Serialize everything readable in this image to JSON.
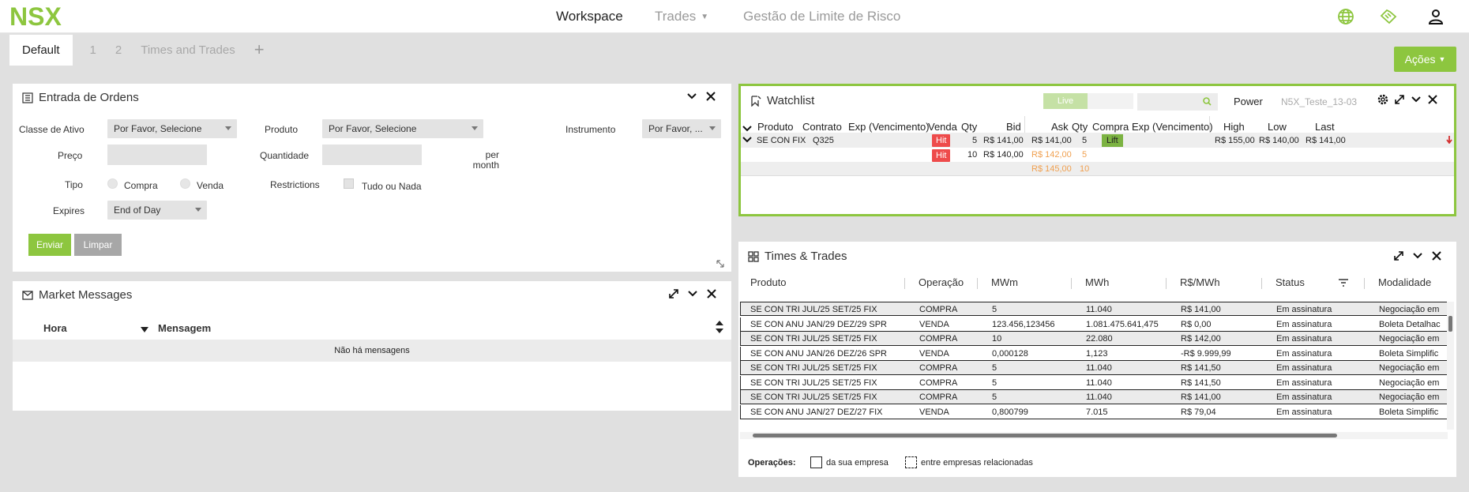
{
  "brand": {
    "logo_text": "NSX",
    "color": "#8dc63f"
  },
  "nav": {
    "workspace": "Workspace",
    "trades": "Trades",
    "gestao": "Gestão de Limite de Risco"
  },
  "top_icons": [
    "globe-icon",
    "handshake-icon",
    "user-icon"
  ],
  "tabs": [
    {
      "label": "Default",
      "active": true
    },
    {
      "label": "1"
    },
    {
      "label": "2"
    },
    {
      "label": "Times and Trades"
    }
  ],
  "tab_add": "+",
  "acoes_label": "Ações",
  "ordens": {
    "title": "Entrada de Ordens",
    "classe_label": "Classe de Ativo",
    "classe_value": "Por Favor, Selecione",
    "produto_label": "Produto",
    "produto_value": "Por Favor, Selecione",
    "instrumento_label": "Instrumento",
    "instrumento_value": "Por Favor, ...",
    "preco_label": "Preço",
    "quantidade_label": "Quantidade",
    "per_month_1": "per",
    "per_month_2": "month",
    "tipo_label": "Tipo",
    "compra_label": "Compra",
    "venda_label": "Venda",
    "restrictions_label": "Restrictions",
    "tudo_label": "Tudo ou Nada",
    "expires_label": "Expires",
    "expires_value": "End of Day",
    "enviar_label": "Enviar",
    "limpar_label": "Limpar"
  },
  "market": {
    "title": "Market Messages",
    "col_hora": "Hora",
    "col_mensagem": "Mensagem",
    "empty": "Não há mensagens"
  },
  "watchlist": {
    "title": "Watchlist",
    "live_label": "Live",
    "power_label": "Power",
    "profile": "N5X_Teste_13-03",
    "headers": {
      "produto": "Produto",
      "contrato": "Contrato",
      "exp1": "Exp (Vencimento)",
      "venda": "Venda",
      "qty1": "Qty",
      "bid": "Bid",
      "ask": "Ask",
      "qty2": "Qty",
      "compra": "Compra",
      "exp2": "Exp (Vencimento)",
      "high": "High",
      "low": "Low",
      "last": "Last"
    },
    "row": {
      "produto": "SE CON FIX",
      "contrato": "Q325",
      "bids": [
        {
          "hit": "Hit",
          "qty": "5",
          "bid": "R$ 141,00"
        },
        {
          "hit": "Hit",
          "qty": "10",
          "bid": "R$ 140,00"
        }
      ],
      "asks": [
        {
          "ask": "R$ 141,00",
          "qty": "5",
          "lift": "Lift"
        },
        {
          "ask": "R$ 142,00",
          "qty": "5"
        },
        {
          "ask": "R$ 145,00",
          "qty": "10"
        }
      ],
      "high": "R$ 155,00",
      "low": "R$ 140,00",
      "last": "R$ 141,00"
    }
  },
  "times": {
    "title": "Times & Trades",
    "headers": [
      "Produto",
      "Operação",
      "MWm",
      "MWh",
      "R$/MWh",
      "Status",
      "Modalidade"
    ],
    "rows": [
      [
        "SE CON TRI JUL/25 SET/25 FIX",
        "COMPRA",
        "5",
        "11.040",
        "R$ 141,00",
        "Em assinatura",
        "Negociação em"
      ],
      [
        "SE CON ANU JAN/29 DEZ/29 SPR",
        "VENDA",
        "123.456,123456",
        "1.081.475.641,475",
        "R$ 0,00",
        "Em assinatura",
        "Boleta Detalhac"
      ],
      [
        "SE CON TRI JUL/25 SET/25 FIX",
        "COMPRA",
        "10",
        "22.080",
        "R$ 142,00",
        "Em assinatura",
        "Negociação em"
      ],
      [
        "SE CON ANU JAN/26 DEZ/26 SPR",
        "VENDA",
        "0,000128",
        "1,123",
        "-R$ 9.999,99",
        "Em assinatura",
        "Boleta Simplific"
      ],
      [
        "SE CON TRI JUL/25 SET/25 FIX",
        "COMPRA",
        "5",
        "11.040",
        "R$ 141,50",
        "Em assinatura",
        "Negociação em"
      ],
      [
        "SE CON TRI JUL/25 SET/25 FIX",
        "COMPRA",
        "5",
        "11.040",
        "R$ 141,50",
        "Em assinatura",
        "Negociação em"
      ],
      [
        "SE CON TRI JUL/25 SET/25 FIX",
        "COMPRA",
        "5",
        "11.040",
        "R$ 141,00",
        "Em assinatura",
        "Negociação em"
      ],
      [
        "SE CON ANU JAN/27 DEZ/27 FIX",
        "VENDA",
        "0,800799",
        "7.015",
        "R$ 79,04",
        "Em assinatura",
        "Boleta Simplific"
      ]
    ],
    "operacoes_label": "Operações:",
    "legend_sua": "da sua empresa",
    "legend_rel": "entre empresas relacionadas"
  },
  "colors": {
    "accent": "#8dc63f",
    "hit": "#ee4b4b",
    "lift": "#7cb342",
    "ask_orange": "#f0a050",
    "last_down": "#d32f2f"
  }
}
